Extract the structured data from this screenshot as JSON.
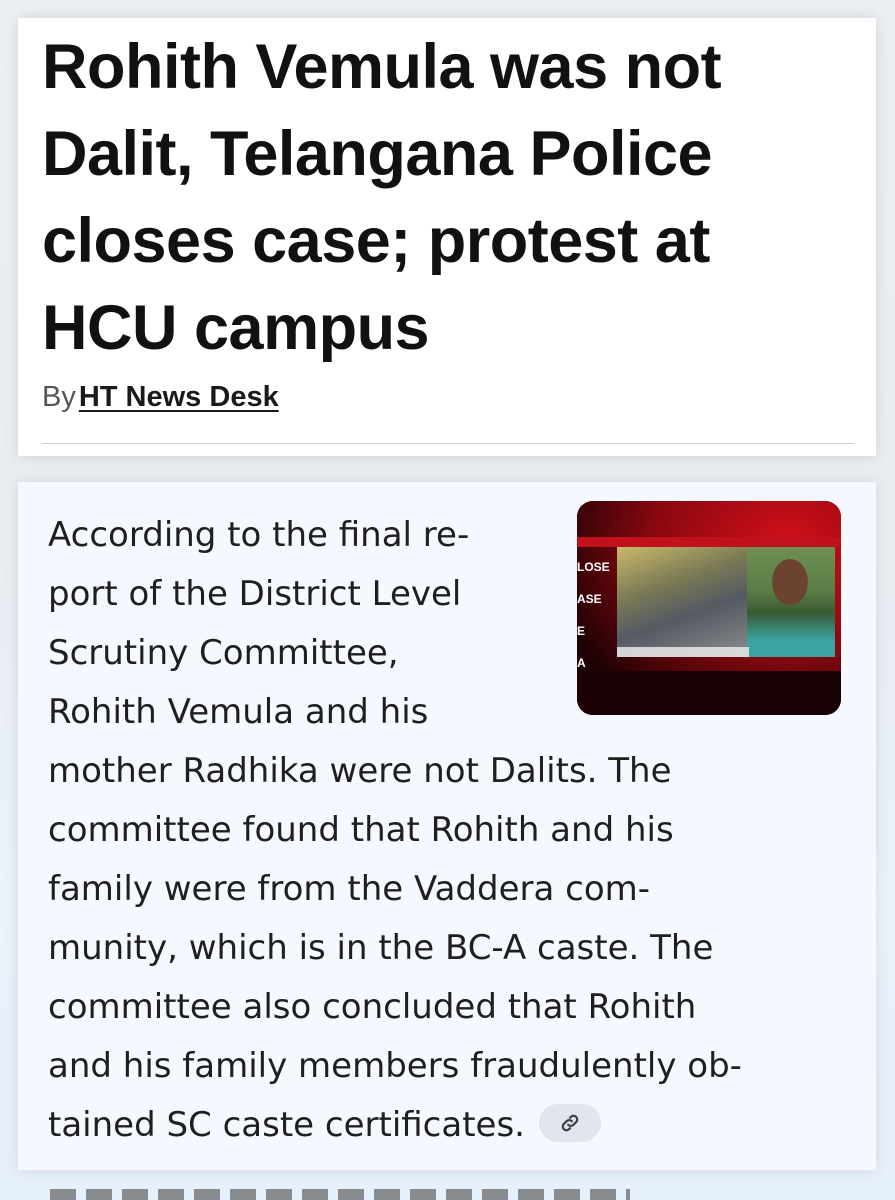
{
  "article": {
    "headline_lines": [
      "Rohith Vemula was not",
      "Dalit, Telangana Police",
      "closes case; protest at",
      "HCU campus"
    ],
    "byline_prefix": "By",
    "author": "HT News Desk"
  },
  "summary": {
    "lines": [
      "According to the final re-",
      "port of the District Level",
      "Scrutiny Committee,",
      "Rohith Vemula and his",
      "mother Radhika were not Dalits. The",
      "committee found that Rohith and his",
      "family were from the Vaddera com-",
      "munity, which is in the BC-A caste. The",
      "committee also concluded that Rohith",
      "and his family members fraudulently ob-",
      "tained SC caste certificates."
    ],
    "link_icon": "link-icon"
  },
  "thumbnail": {
    "overlay_text": [
      "LOSE",
      "ASE",
      "E",
      "A"
    ]
  }
}
